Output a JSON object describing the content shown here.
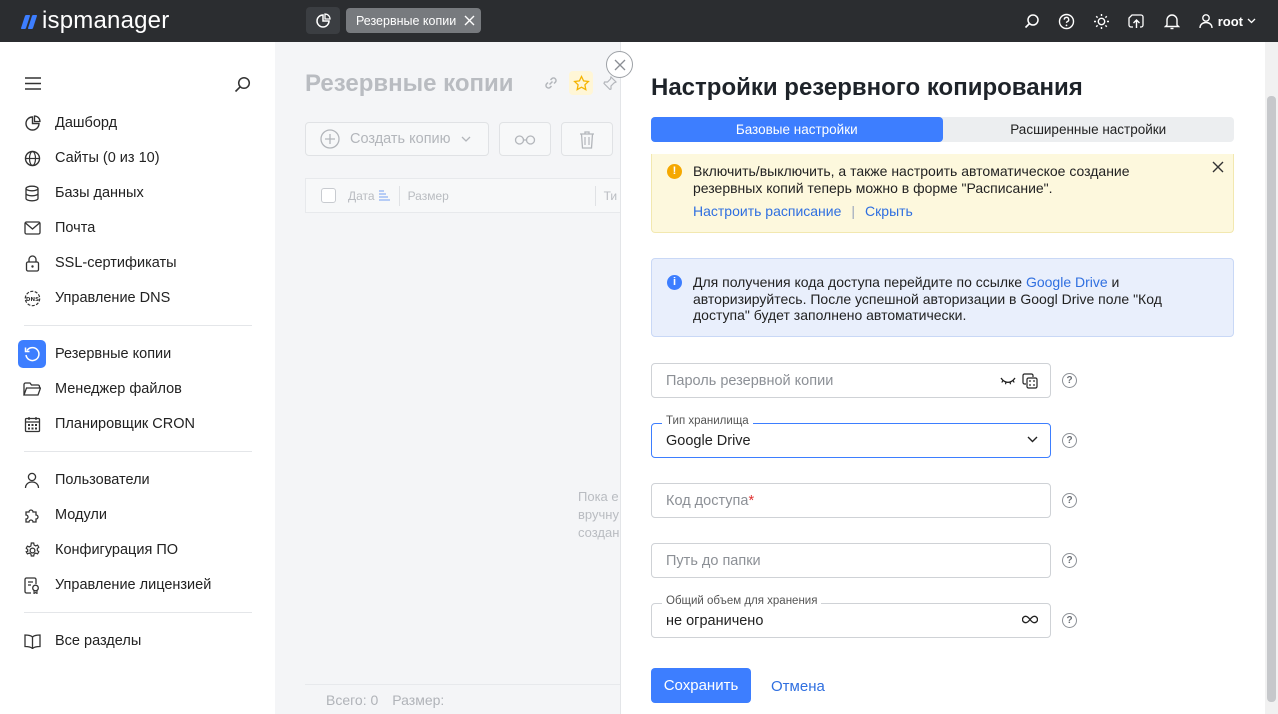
{
  "app": {
    "logo": "ispmanager"
  },
  "topbar": {
    "tab_label": "Резервные копии",
    "user": "root",
    "icons": [
      "search-icon",
      "help-icon",
      "theme-icon",
      "upload-icon",
      "bell-icon",
      "user-icon"
    ]
  },
  "sidebar": {
    "items": [
      {
        "label": "Дашборд",
        "icon": "dashboard-icon"
      },
      {
        "label": "Сайты (0 из 10)",
        "icon": "globe-icon"
      },
      {
        "label": "Базы данных",
        "icon": "database-icon"
      },
      {
        "label": "Почта",
        "icon": "mail-icon"
      },
      {
        "label": "SSL-сертификаты",
        "icon": "lock-icon"
      },
      {
        "label": "Управление DNS",
        "icon": "dns-icon"
      },
      {
        "label": "Резервные копии",
        "icon": "backup-icon",
        "active": true
      },
      {
        "label": "Менеджер файлов",
        "icon": "folder-icon"
      },
      {
        "label": "Планировщик CRON",
        "icon": "calendar-icon"
      },
      {
        "label": "Пользователи",
        "icon": "user-icon"
      },
      {
        "label": "Модули",
        "icon": "puzzle-icon"
      },
      {
        "label": "Конфигурация ПО",
        "icon": "gear-icon"
      },
      {
        "label": "Управление лицензией",
        "icon": "license-icon"
      },
      {
        "label": "Все разделы",
        "icon": "book-icon"
      }
    ]
  },
  "page": {
    "title": "Резервные копии",
    "create_button": "Создать копию",
    "columns": [
      "Дата",
      "Размер",
      "Ти"
    ],
    "empty_lines": [
      "Пока е",
      "вручну",
      "создан"
    ],
    "footer_total": "Всего: 0",
    "footer_size": "Размер:"
  },
  "panel": {
    "title": "Настройки резервного копирования",
    "tabs": [
      "Базовые настройки",
      "Расширенные настройки"
    ],
    "warn": {
      "text": "Включить/выключить, а также настроить автоматическое создание резервных копий теперь можно в форме \"Расписание\".",
      "link1": "Настроить расписание",
      "separator": "|",
      "link2": "Скрыть"
    },
    "info": {
      "text_before": "Для получения кода доступа перейдите по ссылке ",
      "link": "Google Drive",
      "text_after": " и авторизируйтесь. После успешной авторизации в Googl Drive поле \"Код доступа\" будет заполнено автоматически."
    },
    "fields": {
      "password_placeholder": "Пароль резервной копии",
      "storage_legend": "Тип хранилища",
      "storage_value": "Google Drive",
      "code_placeholder": "Код доступа",
      "code_required": "*",
      "path_placeholder": "Путь до папки",
      "volume_legend": "Общий объем для хранения",
      "volume_value": "не ограничено"
    },
    "help_mark": "?",
    "save": "Сохранить",
    "cancel": "Отмена"
  },
  "colors": {
    "accent": "#3d7eff",
    "topbar": "#2b2d30",
    "warn_bg": "#fdf8dd",
    "info_bg": "#e9effc"
  }
}
